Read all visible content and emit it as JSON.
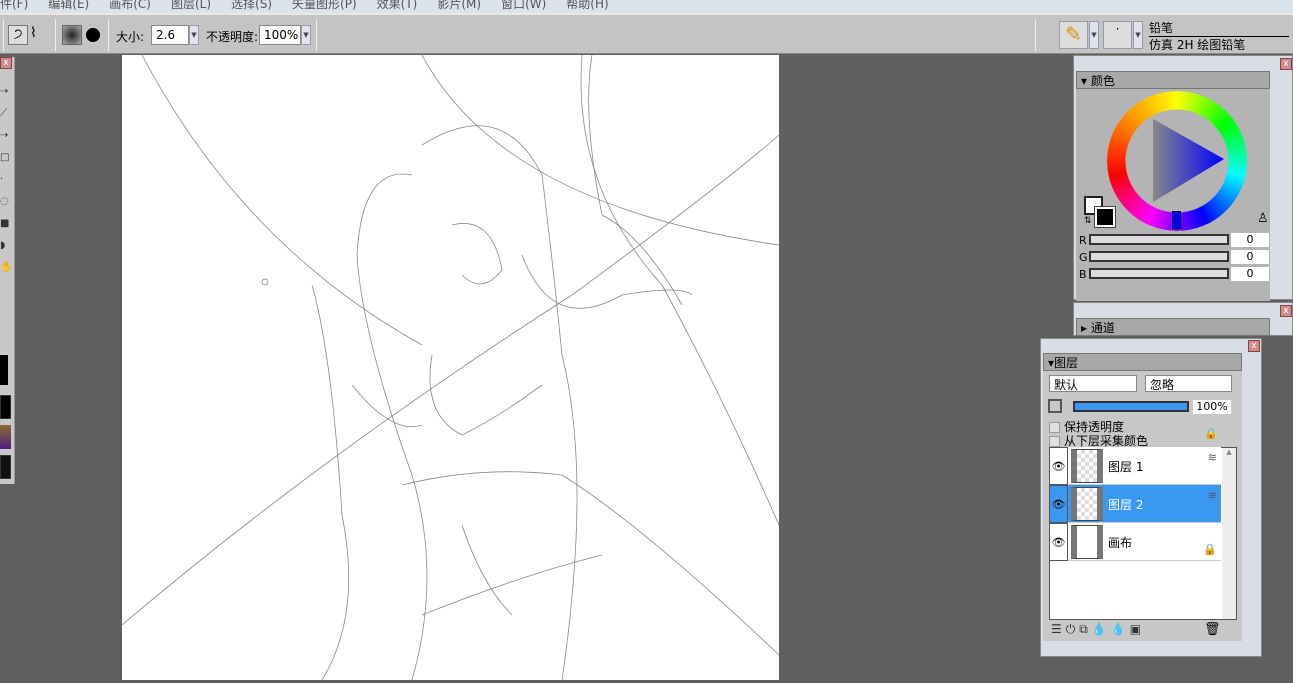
{
  "menu": [
    "件(F)",
    "编辑(E)",
    "画布(C)",
    "图层(L)",
    "选择(S)",
    "矢量图形(P)",
    "效果(T)",
    "影片(M)",
    "窗口(W)",
    "帮助(H)"
  ],
  "toolbar": {
    "size_label": "大小:",
    "size_value": "2.6",
    "opacity_label": "不透明度:",
    "opacity_value": "100%",
    "brush_name": "铅笔",
    "brush_variant": "仿真 2H 绘图铅笔"
  },
  "color_panel": {
    "title": "颜色",
    "channels": [
      {
        "label": "R",
        "value": "0"
      },
      {
        "label": "G",
        "value": "0"
      },
      {
        "label": "B",
        "value": "0"
      }
    ],
    "hue_indicator": "#0000ff"
  },
  "channel_panel": {
    "title": "通道"
  },
  "layers_panel": {
    "title": "图层",
    "blend_mode": "默认",
    "composite": "忽略",
    "opacity": "100%",
    "opacity_fraction": 1.0,
    "preserve_transparency": "保持透明度",
    "pick_up_color": "从下层采集颜色",
    "layers": [
      {
        "name": "图层 1",
        "selected": false
      },
      {
        "name": "图层 2",
        "selected": true
      },
      {
        "name": "画布",
        "selected": false
      }
    ]
  }
}
